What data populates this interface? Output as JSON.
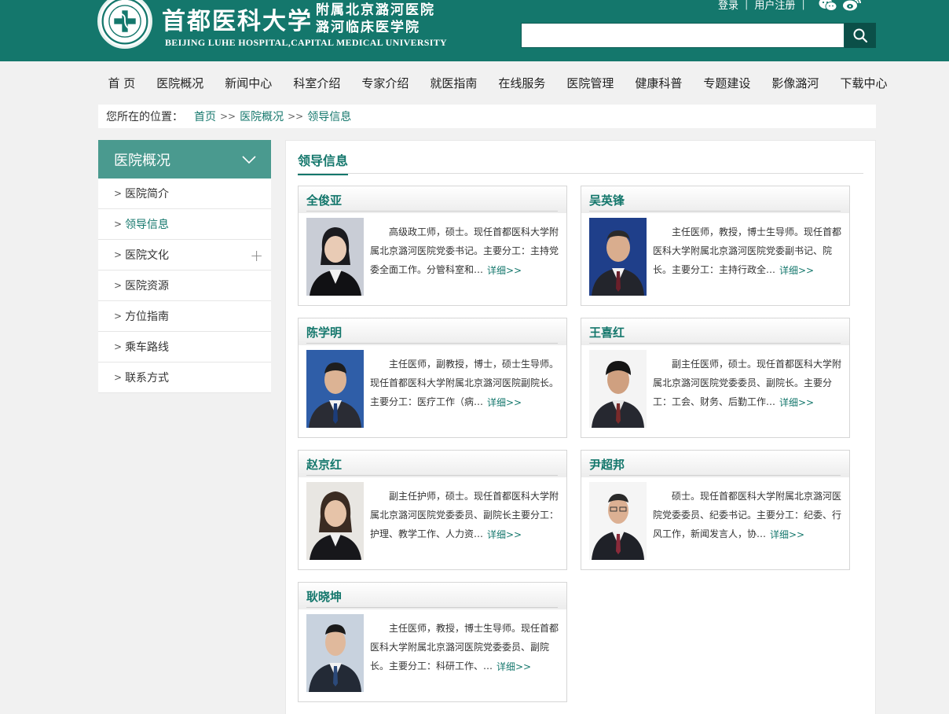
{
  "header": {
    "logo_cn_main": "首都医科大学",
    "logo_cn_sub_line1": "附属北京潞河医院",
    "logo_cn_sub_line2": "潞河临床医学院",
    "logo_en": "BEIJING LUHE HOSPITAL,CAPITAL MEDICAL UNIVERSITY",
    "login": "登录",
    "register": "用户注册",
    "separator": "|",
    "search_placeholder": ""
  },
  "nav": [
    "首 页",
    "医院概况",
    "新闻中心",
    "科室介绍",
    "专家介绍",
    "就医指南",
    "在线服务",
    "医院管理",
    "健康科普",
    "专题建设",
    "影像潞河",
    "下载中心"
  ],
  "breadcrumb": {
    "label": "您所在的位置：",
    "items": [
      "首页",
      "医院概况",
      "领导信息"
    ],
    "sep": ">>"
  },
  "sidebar": {
    "title": "医院概况",
    "items": [
      {
        "label": "医院简介"
      },
      {
        "label": "领导信息"
      },
      {
        "label": "医院文化"
      },
      {
        "label": "医院资源"
      },
      {
        "label": "方位指南"
      },
      {
        "label": "乘车路线"
      },
      {
        "label": "联系方式"
      }
    ],
    "chev": ">",
    "plus": "+"
  },
  "main": {
    "title": "领导信息",
    "more_label": "详细>>",
    "leaders": [
      {
        "name": "全俊亚",
        "desc": "高级政工师，硕士。现任首都医科大学附属北京潞河医院党委书记。主要分工：主持党委全面工作。分管科室和…"
      },
      {
        "name": "吴英锋",
        "desc": "主任医师，教授，博士生导师。现任首都医科大学附属北京潞河医院党委副书记、院长。主要分工：主持行政全…"
      },
      {
        "name": "陈学明",
        "desc": "主任医师，副教授，博士，硕士生导师。现任首都医科大学附属北京潞河医院副院长。主要分工：医疗工作（病…"
      },
      {
        "name": "王喜红",
        "desc": "副主任医师，硕士。现任首都医科大学附属北京潞河医院党委委员、副院长。主要分工：工会、财务、后勤工作…"
      },
      {
        "name": "赵京红",
        "desc": "副主任护师，硕士。现任首都医科大学附属北京潞河医院党委委员、副院长主要分工：护理、教学工作、人力资…"
      },
      {
        "name": "尹超邦",
        "desc": "硕士。现任首都医科大学附属北京潞河医院党委委员、纪委书记。主要分工：纪委、行风工作，新闻发言人，协…"
      },
      {
        "name": "耿晓坤",
        "desc": "主任医师，教授，博士生导师。现任首都医科大学附属北京潞河医院党委委员、副院长。主要分工：科研工作、…"
      }
    ]
  },
  "colors": {
    "brand": "#14776c",
    "brand_dark": "#0b4f48",
    "sidebar_head": "#4a9a8f"
  },
  "icons": [
    "hospital-emblem-icon",
    "wechat-icon",
    "weibo-icon",
    "search-icon",
    "chevron-down-icon",
    "chevron-right-icon",
    "plus-icon"
  ]
}
